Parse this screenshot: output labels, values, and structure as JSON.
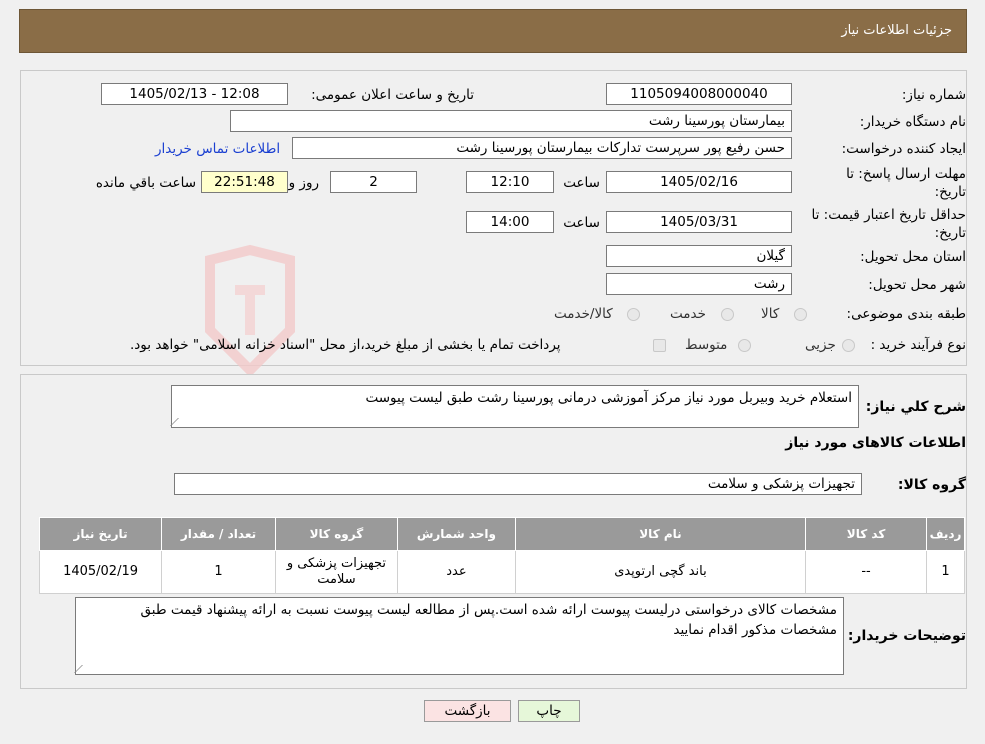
{
  "header": {
    "title": "جزئیات اطلاعات نیاز"
  },
  "form": {
    "need_number_label": "شماره نیاز:",
    "need_number": "1105094008000040",
    "announce_label": "تاریخ و ساعت اعلان عمومی:",
    "announce_value": "1405/02/13 - 12:08",
    "buyer_org_label": "نام دستگاه خریدار:",
    "buyer_org": "بیمارستان پورسینا رشت",
    "creator_label": "ایجاد کننده درخواست:",
    "creator": "حسن رفیع پور سرپرست تدارکات بیمارستان پورسینا رشت",
    "contact_link": "اطلاعات تماس خریدار",
    "deadline_label_1": "مهلت ارسال پاسخ: تا",
    "deadline_label_2": "تاریخ:",
    "deadline_date": "1405/02/16",
    "time_label": "ساعت",
    "deadline_time": "12:10",
    "days_value": "2",
    "days_label": "روز و",
    "remaining_time": "22:51:48",
    "remaining_label": "ساعت باقي مانده",
    "validity_label_1": "حداقل تاریخ اعتبار قیمت: تا",
    "validity_label_2": "تاریخ:",
    "validity_date": "1405/03/31",
    "validity_time": "14:00",
    "province_label": "استان محل تحویل:",
    "province": "گیلان",
    "city_label": "شهر محل تحویل:",
    "city": "رشت",
    "category_label": "طبقه بندی موضوعی:",
    "category_options": [
      "کالا",
      "خدمت",
      "کالا/خدمت"
    ],
    "process_label": "نوع فرآیند خرید :",
    "process_options": [
      "جزیی",
      "متوسط"
    ],
    "process_note": "پرداخت تمام یا بخشی از مبلغ خرید،از محل \"اسناد خزانه اسلامی\" خواهد بود."
  },
  "summary": {
    "desc_label": "شرح کلي نياز:",
    "desc_value": "استعلام خرید وبیربل مورد نیاز مرکز آموزشی درمانی پورسینا رشت طبق لیست پیوست",
    "items_title": "اطلاعات کالاهای مورد نیاز",
    "group_label": "گروه کالا:",
    "group_value": "تجهیزات پزشکی و سلامت",
    "columns": [
      "ردیف",
      "کد کالا",
      "نام کالا",
      "واحد شمارش",
      "گروه کالا",
      "تعداد / مقدار",
      "تاریخ نیاز"
    ],
    "rows": [
      {
        "row": "1",
        "code": "--",
        "name": "باند گچی ارتوپدی",
        "unit": "عدد",
        "group": "تجهیزات پزشکی و سلامت",
        "qty": "1",
        "date": "1405/02/19"
      }
    ],
    "buyer_notes_label": "توضیحات خریدار:",
    "buyer_notes": "مشخصات کالای درخواستی درلیست پیوست ارائه شده است.پس از مطالعه لیست پیوست نسبت به ارائه پیشنهاد قیمت طبق مشخصات مذکور اقدام نمایید"
  },
  "buttons": {
    "print": "چاپ",
    "back": "بازگشت"
  },
  "colors": {
    "header": "#8a6d47",
    "print_btn": "#e6f7d9",
    "back_btn": "#fbe3e3",
    "link": "#1a3fd1"
  }
}
